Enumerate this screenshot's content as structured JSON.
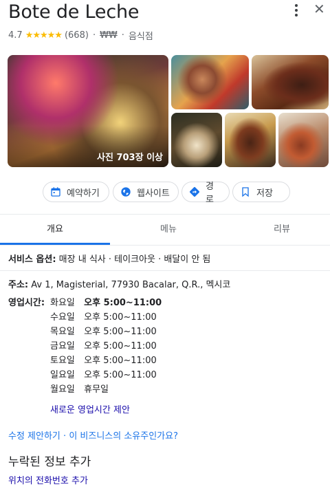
{
  "place": {
    "name": "Bote de Leche",
    "rating": "4.7",
    "stars": "★★★★★",
    "review_count": "(668)",
    "price_level": "₩₩",
    "category": "음식점"
  },
  "photos": {
    "count_label": "사진 703장 이상"
  },
  "actions": {
    "reserve": "예약하기",
    "website": "웹사이트",
    "route": "경로",
    "save": "저장"
  },
  "tabs": {
    "overview": "개요",
    "menu": "메뉴",
    "reviews": "리뷰"
  },
  "service": {
    "label": "서비스 옵션:",
    "value": "매장 내 식사 · 테이크아웃 · 배달이 안 됨"
  },
  "address": {
    "label": "주소:",
    "value": "Av 1, Magisterial, 77930 Bacalar, Q.R., 멕시코"
  },
  "hours": {
    "label": "영업시간:",
    "rows": [
      {
        "day": "화요일",
        "time": "오후 5:00~11:00",
        "today": true
      },
      {
        "day": "수요일",
        "time": "오후 5:00~11:00"
      },
      {
        "day": "목요일",
        "time": "오후 5:00~11:00"
      },
      {
        "day": "금요일",
        "time": "오후 5:00~11:00"
      },
      {
        "day": "토요일",
        "time": "오후 5:00~11:00"
      },
      {
        "day": "일요일",
        "time": "오후 5:00~11:00"
      },
      {
        "day": "월요일",
        "time": "휴무일"
      }
    ],
    "suggest_link": "새로운 영업시간 제안"
  },
  "footer_links": {
    "suggest_edit": "수정 제안하기",
    "separator": " · ",
    "owner": "이 비즈니스의 소유주인가요?"
  },
  "missing": {
    "title": "누락된 정보 추가",
    "add_phone": "위치의 전화번호 추가"
  },
  "colors": {
    "accent": "#1a73e8",
    "star": "#fbbc04",
    "link": "#1a0dab"
  }
}
